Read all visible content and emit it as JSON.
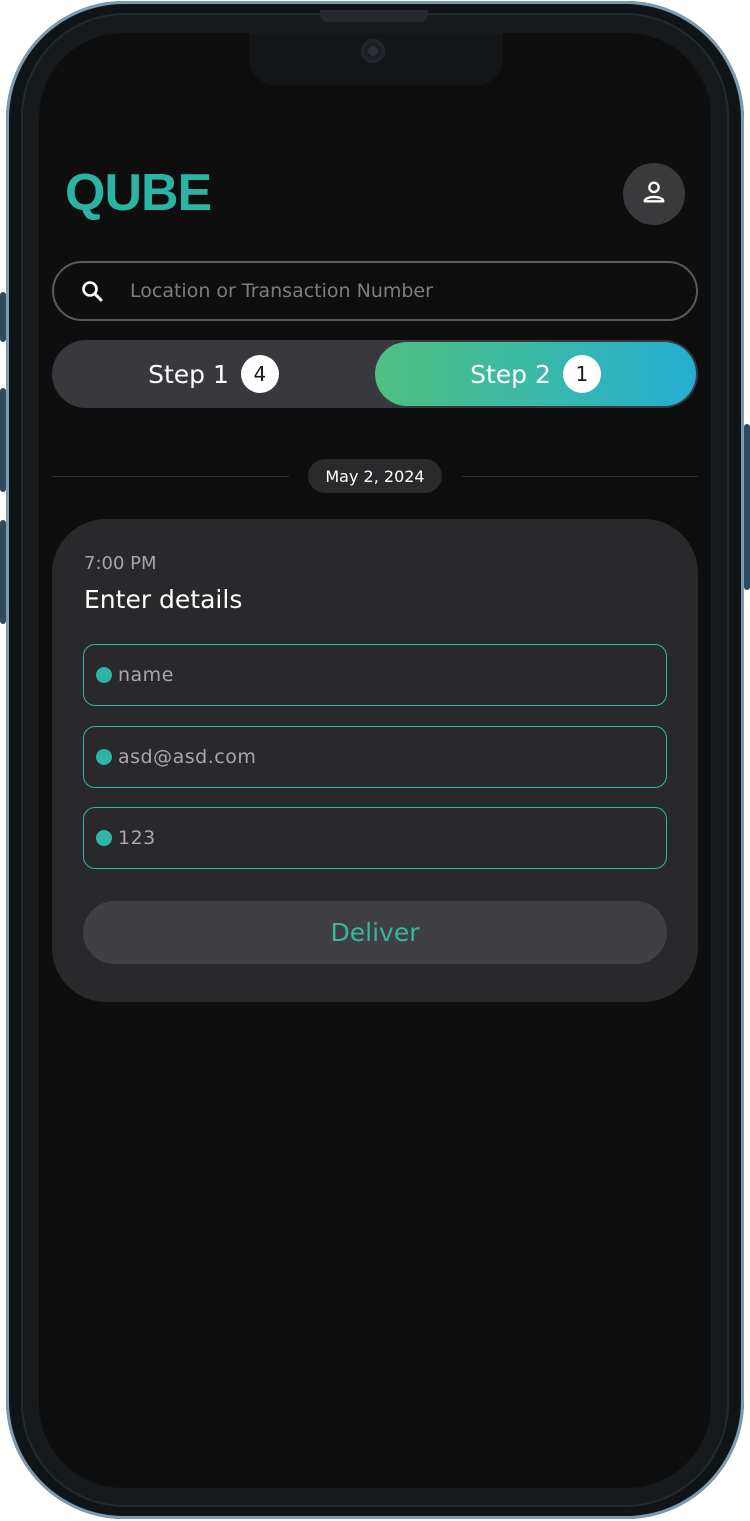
{
  "app": {
    "logo": "QUBE"
  },
  "header": {
    "profile_icon": "user-icon"
  },
  "search": {
    "icon": "search-icon",
    "placeholder": "Location or Transaction Number",
    "value": ""
  },
  "steps": [
    {
      "label": "Step 1",
      "count": "4",
      "active": false
    },
    {
      "label": "Step 2",
      "count": "1",
      "active": true
    }
  ],
  "date_divider": {
    "label": "May 2, 2024"
  },
  "card": {
    "time": "7:00 PM",
    "title": "Enter details",
    "fields": [
      {
        "value": "name"
      },
      {
        "value": "asd@asd.com"
      },
      {
        "value": "123"
      }
    ],
    "deliver_label": "Deliver"
  },
  "colors": {
    "accent": "#2bb3a4",
    "gradient_start": "#4fc082",
    "gradient_end": "#24aed4",
    "background": "#0e0e0f",
    "card": "#29282b"
  }
}
